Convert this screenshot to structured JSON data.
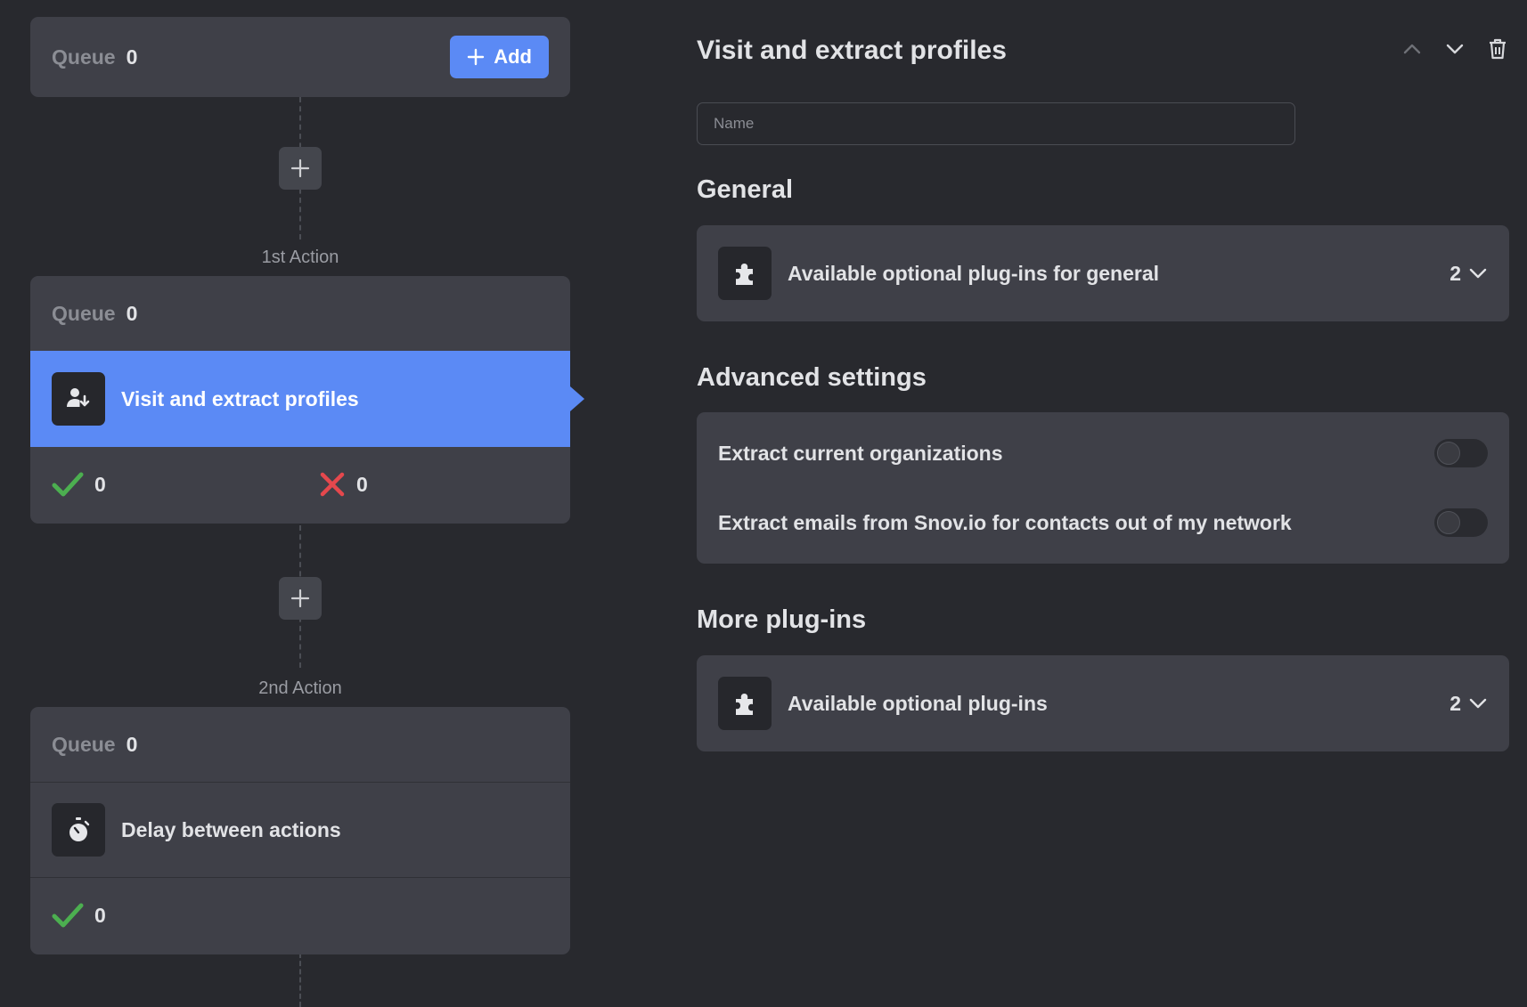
{
  "flow": {
    "top_card": {
      "queue_label": "Queue",
      "queue_count": "0",
      "add_label": "Add"
    },
    "actions": [
      {
        "label": "1st Action",
        "queue_label": "Queue",
        "queue_count": "0",
        "title": "Visit and extract profiles",
        "icon": "user-download-icon",
        "success_count": "0",
        "fail_count": "0",
        "active": true
      },
      {
        "label": "2nd Action",
        "queue_label": "Queue",
        "queue_count": "0",
        "title": "Delay between actions",
        "icon": "stopwatch-icon",
        "success_count": "0",
        "active": false
      }
    ]
  },
  "panel": {
    "title": "Visit and extract profiles",
    "name_placeholder": "Name",
    "general": {
      "title": "General",
      "plugins_label": "Available optional plug-ins for general",
      "plugins_count": "2"
    },
    "advanced": {
      "title": "Advanced settings",
      "options": [
        {
          "label": "Extract current organizations",
          "enabled": false
        },
        {
          "label": "Extract emails from Snov.io for contacts out of my network",
          "enabled": false
        }
      ]
    },
    "more": {
      "title": "More plug-ins",
      "plugins_label": "Available optional plug-ins",
      "plugins_count": "2"
    }
  },
  "colors": {
    "background": "#28292e",
    "card": "#3f4048",
    "accent": "#5b8af5",
    "success": "#4caf50",
    "error": "#e5484d"
  }
}
